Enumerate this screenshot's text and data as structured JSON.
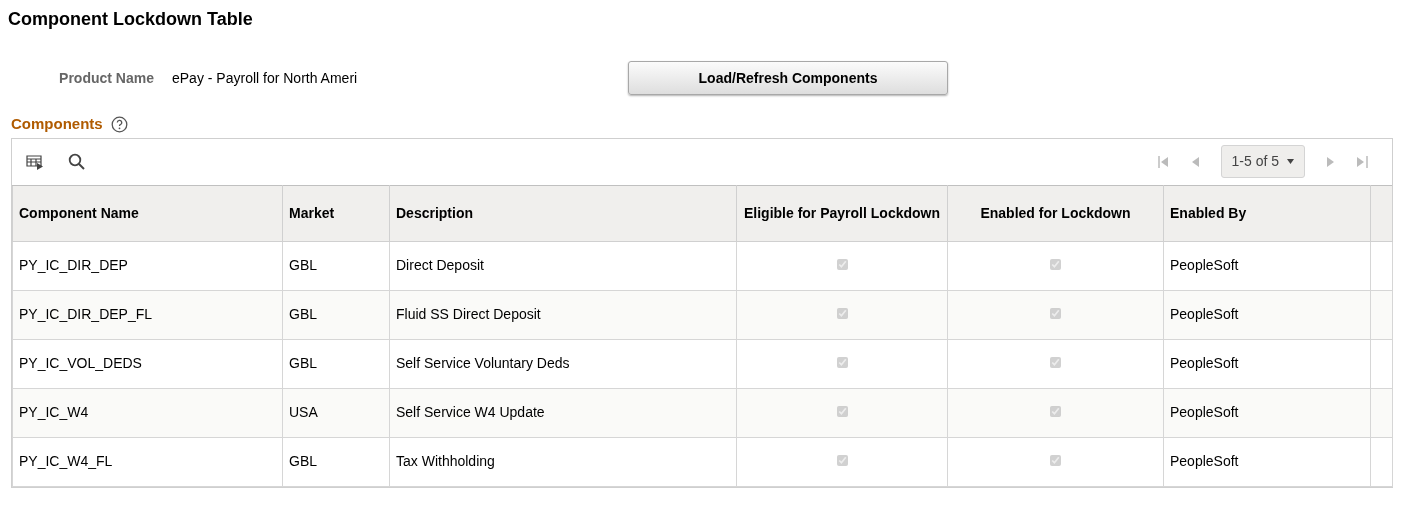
{
  "page_title": "Component Lockdown Table",
  "product": {
    "label": "Product Name",
    "value": "ePay - Payroll for North Ameri"
  },
  "load_button": "Load/Refresh Components",
  "grid": {
    "title": "Components",
    "pager": "1-5 of 5",
    "columns": [
      "Component Name",
      "Market",
      "Description",
      "Eligible for Payroll Lockdown",
      "Enabled for Lockdown",
      "Enabled By"
    ],
    "rows": [
      {
        "component": "PY_IC_DIR_DEP",
        "market": "GBL",
        "description": "Direct Deposit",
        "eligible": {
          "checked": true,
          "disabled": true
        },
        "enabled": {
          "checked": true,
          "disabled": true
        },
        "enabled_by": "PeopleSoft"
      },
      {
        "component": "PY_IC_DIR_DEP_FL",
        "market": "GBL",
        "description": "Fluid SS Direct Deposit",
        "eligible": {
          "checked": true,
          "disabled": true
        },
        "enabled": {
          "checked": true,
          "disabled": true
        },
        "enabled_by": "PeopleSoft"
      },
      {
        "component": "PY_IC_VOL_DEDS",
        "market": "GBL",
        "description": "Self Service Voluntary Deds",
        "eligible": {
          "checked": true,
          "disabled": true
        },
        "enabled": {
          "checked": true,
          "disabled": true
        },
        "enabled_by": "PeopleSoft"
      },
      {
        "component": "PY_IC_W4",
        "market": "USA",
        "description": "Self Service W4 Update",
        "eligible": {
          "checked": true,
          "disabled": true
        },
        "enabled": {
          "checked": true,
          "disabled": true
        },
        "enabled_by": "PeopleSoft"
      },
      {
        "component": "PY_IC_W4_FL",
        "market": "GBL",
        "description": "Tax Withholding",
        "eligible": {
          "checked": true,
          "disabled": true
        },
        "enabled": {
          "checked": true,
          "disabled": true
        },
        "enabled_by": "PeopleSoft"
      }
    ]
  }
}
